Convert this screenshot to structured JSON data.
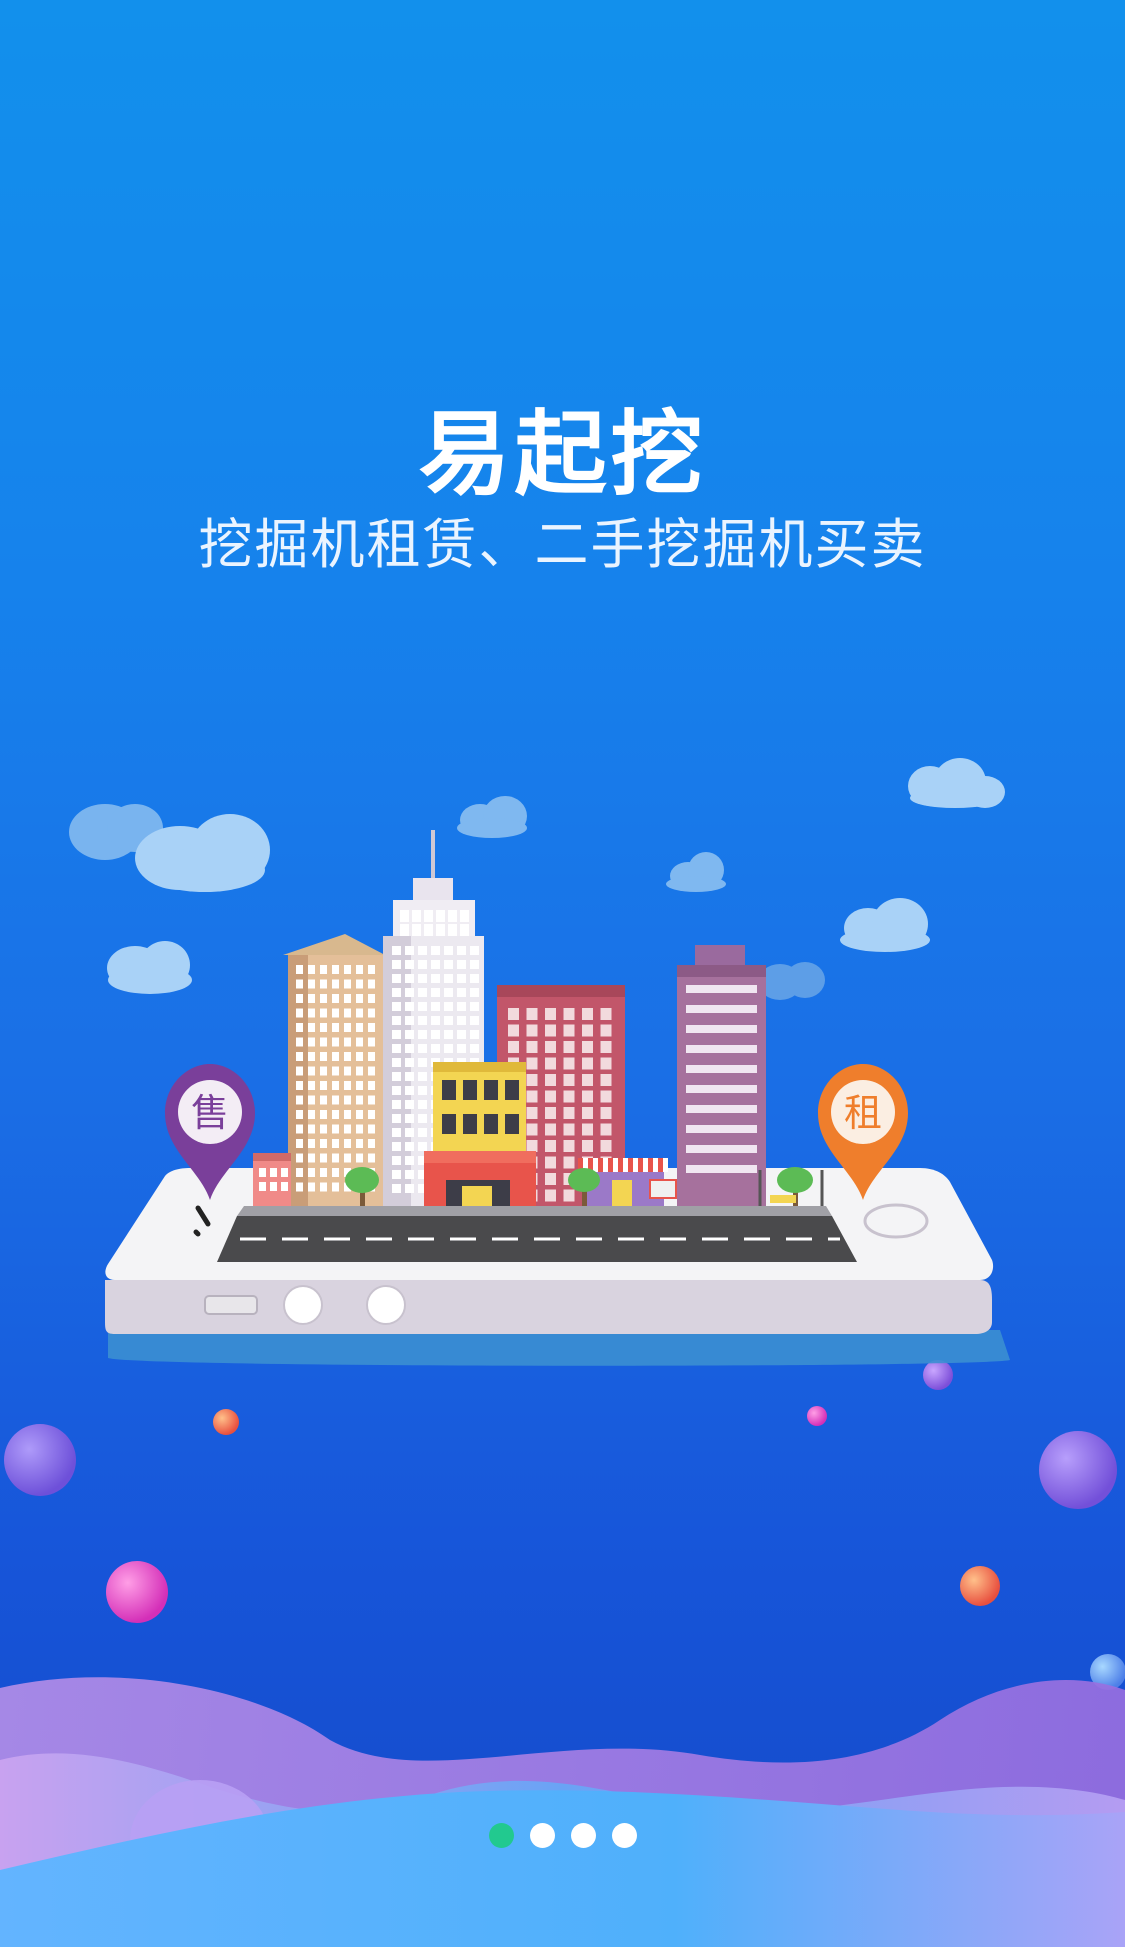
{
  "splash": {
    "title": "易起挖",
    "subtitle": "挖掘机租赁、二手挖掘机买卖"
  },
  "illustration": {
    "sale_pin_label": "售",
    "rent_pin_label": "租"
  },
  "pager": {
    "total": 4,
    "active_index": 0
  },
  "colors": {
    "background_top": "#1290ec",
    "background_bottom": "#1449c8",
    "text": "#ffffff",
    "active_dot": "#22c98f",
    "inactive_dot": "#ffffff",
    "sale_pin": "#7a3f9a",
    "rent_pin": "#ef7e2c"
  }
}
